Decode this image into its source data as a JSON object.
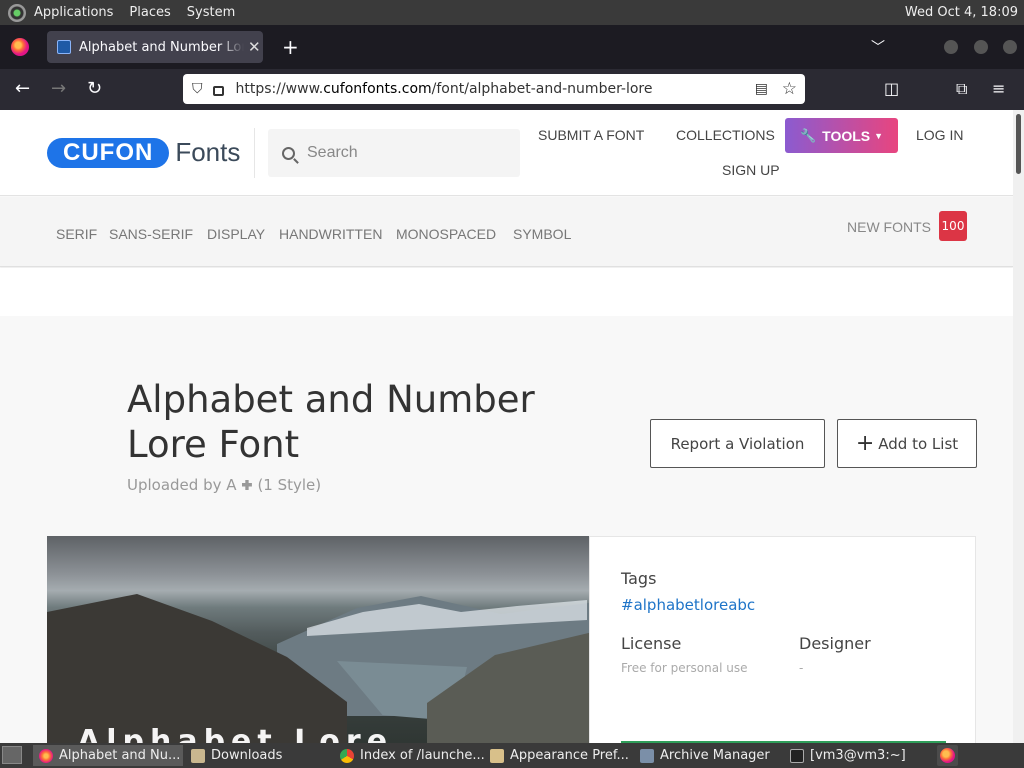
{
  "top_panel": {
    "menus": [
      "Applications",
      "Places",
      "System"
    ],
    "clock": "Wed Oct  4, 18:09"
  },
  "browser": {
    "tab_title": "Alphabet and Number Lore F",
    "url_prefix": "https://www.",
    "url_domain": "cufonfonts.com",
    "url_path": "/font/alphabet-and-number-lore"
  },
  "site": {
    "logo_pill": "CUFON",
    "logo_text": "Fonts",
    "search_placeholder": "Search",
    "nav": {
      "submit": "SUBMIT A FONT",
      "collections": "COLLECTIONS",
      "tools": "TOOLS",
      "login": "LOG IN",
      "signup": "SIGN UP"
    },
    "categories": [
      "SERIF",
      "SANS-SERIF",
      "DISPLAY",
      "HANDWRITTEN",
      "MONOSPACED",
      "SYMBOL"
    ],
    "new_fonts_label": "NEW FONTS",
    "new_fonts_count": "100",
    "accent_color": "#1e74e8",
    "badge_color": "#dc3545"
  },
  "font_page": {
    "title": "Alphabet and Number Lore Font",
    "uploaded_by": "Uploaded by A 🞧 (1 Style)",
    "report_button": "Report a Violation",
    "add_list_button": "Add to List",
    "preview_text": "Alphabet Lore",
    "tags_label": "Tags",
    "tag": "#alphabetloreabc",
    "license_label": "License",
    "license_value": "Free for personal use",
    "designer_label": "Designer",
    "designer_value": "-"
  },
  "taskbar": {
    "tasks": [
      "Alphabet and Nu...",
      "Downloads",
      "Index of /launche...",
      "Appearance Pref...",
      "Archive Manager",
      "[vm3@vm3:~]"
    ]
  }
}
